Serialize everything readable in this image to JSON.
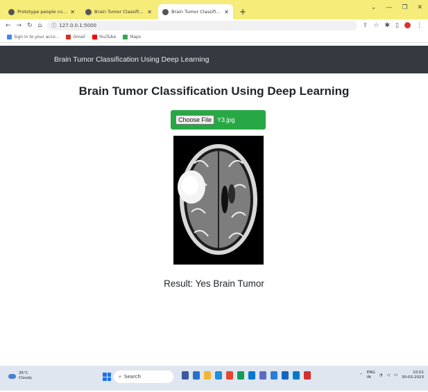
{
  "browser": {
    "tabs": [
      {
        "title": "Prototype people compare all Chat",
        "active": false
      },
      {
        "title": "Brain Tumor Classification Using",
        "active": false
      },
      {
        "title": "Brain Tumor Classification Using",
        "active": true
      }
    ],
    "address": "127.0.0.1:5000",
    "bookmarks": [
      {
        "label": "Sign in to your acco...",
        "color": "#4285f4"
      },
      {
        "label": "Gmail",
        "color": "#d93025"
      },
      {
        "label": "YouTube",
        "color": "#ff0000"
      },
      {
        "label": "Maps",
        "color": "#34a853"
      }
    ]
  },
  "page": {
    "navbar_brand": "Brain Tumor Classification Using Deep Learning",
    "heading": "Brain Tumor Classification Using Deep Learning",
    "upload": {
      "button_label": "Choose File",
      "filename": "Y3.jpg"
    },
    "result": "Result: Yes Brain Tumor",
    "colors": {
      "navbar": "#343a40",
      "upload_bg": "#28a745"
    }
  },
  "taskbar": {
    "weather_temp": "35°C",
    "weather_desc": "Cloudy",
    "search_label": "Search",
    "tray_lang": "ENG",
    "tray_region": "IN",
    "time": "10:01",
    "date": "30-03-2023"
  }
}
